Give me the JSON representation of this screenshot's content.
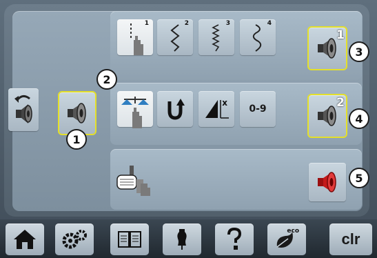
{
  "row1": {
    "stitch_buttons": [
      {
        "sup": "1"
      },
      {
        "sup": "2"
      },
      {
        "sup": "3"
      },
      {
        "sup": "4"
      }
    ],
    "sound_number": "1"
  },
  "row2": {
    "number_button_label": "0-9",
    "mirror_label": "x",
    "sound_number": "2"
  },
  "callouts": [
    "1",
    "2",
    "3",
    "4",
    "5"
  ],
  "bottom_nav": {
    "eco_label": "eco",
    "clr_label": "clr"
  },
  "colors": {
    "highlight": "#e4e02a",
    "speaker_off": "#d22020"
  }
}
